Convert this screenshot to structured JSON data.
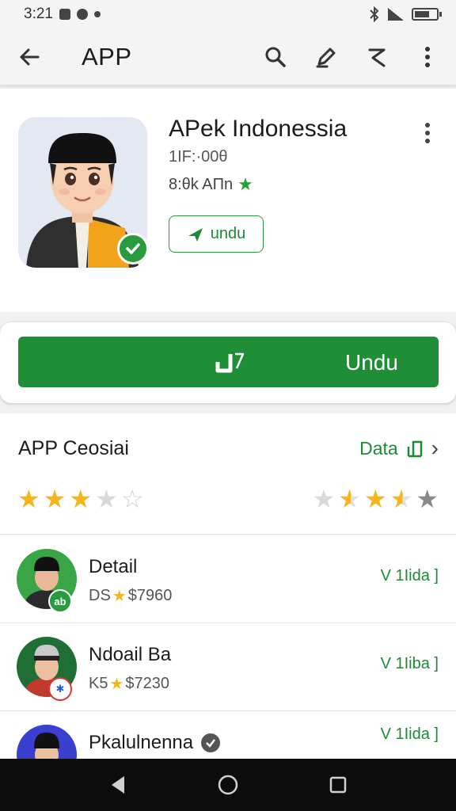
{
  "status_bar": {
    "time": "3:21",
    "icons": [
      "screenshot-icon",
      "message-icon",
      "dot-icon",
      "bluetooth-icon",
      "signal-icon",
      "battery-icon"
    ],
    "battery_level": 0.7
  },
  "app_bar": {
    "title": "APP",
    "icons": [
      "arrow-back-icon",
      "search-icon",
      "edit-icon",
      "share-icon",
      "more-vert-icon"
    ]
  },
  "app_header": {
    "name": "APek Indonessia",
    "meta": "1IF:·00θ",
    "rating_text": "8:θk AΠn",
    "secondary_button_label": "undu",
    "colors": {
      "accent": "#1f8e36",
      "badge": "#2a9a3e"
    }
  },
  "install": {
    "label": "Undu",
    "icon": "download-icon"
  },
  "ratings": {
    "title": "APP Ceosiai",
    "link_label": "Data",
    "stars_left": [
      "full",
      "full",
      "full",
      "empty",
      "outline"
    ],
    "stars_right": [
      "empty",
      "half",
      "full",
      "half",
      "grey"
    ]
  },
  "list_items": [
    {
      "title": "Detail",
      "sub_prefix": "DS",
      "sub_value": "$7960",
      "action": "V 1Iida ]",
      "badge_text": "ab",
      "verified": false
    },
    {
      "title": "Ndoail Ba",
      "sub_prefix": "K5",
      "sub_value": "$7230",
      "action": "V 1Iiba ]",
      "badge_text": "✱",
      "verified": false
    },
    {
      "title": "Pkalulnenna",
      "sub_prefix": "",
      "sub_value": "",
      "action": "V 1Iida ]",
      "badge_text": "",
      "verified": true
    }
  ],
  "nav_bar": {
    "buttons": [
      "back-triangle-icon",
      "home-circle-icon",
      "recents-square-icon"
    ]
  }
}
